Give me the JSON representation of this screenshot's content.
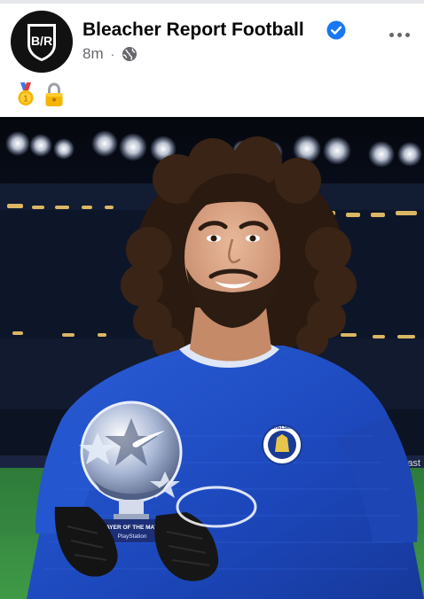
{
  "post": {
    "author": "Bleacher Report Football",
    "avatar_text": "B/R",
    "time": "8m",
    "separator": "·",
    "privacy_icon": "globe-icon",
    "verified_icon": "verified-badge-icon",
    "more_icon": "more-options-icon",
    "caption_icons": [
      "medal-emoji-icon",
      "lock-emoji-icon"
    ]
  },
  "photo": {
    "trophy_plate": "PLAYER OF THE MATCH",
    "trophy_sponsor": "PlayStation",
    "crest_text": "CHELSEA",
    "board_text": "mast"
  },
  "colors": {
    "verified": "#1877f2",
    "meta": "#65676b",
    "jersey": "#1f4fc9"
  }
}
